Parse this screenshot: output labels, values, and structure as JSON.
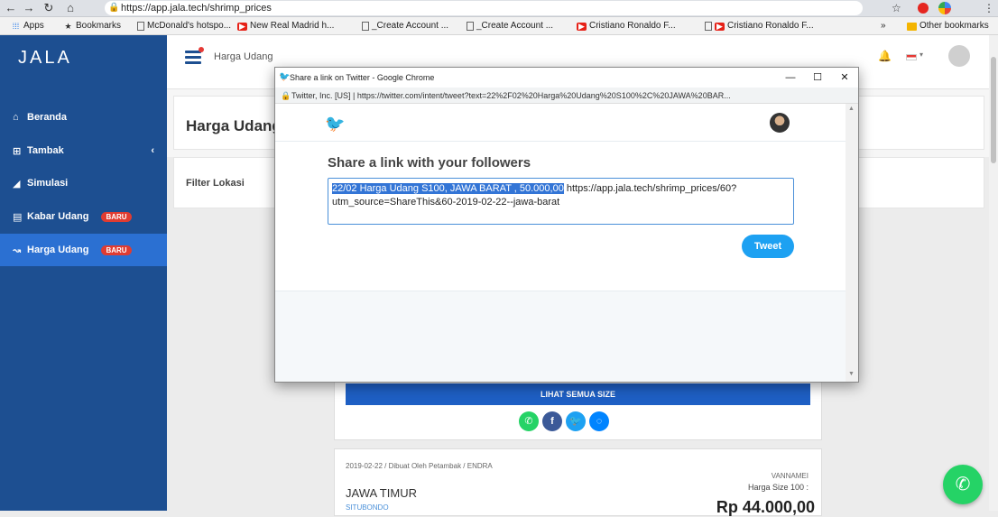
{
  "browser": {
    "url": "https://app.jala.tech/shrimp_prices",
    "bookmarks": [
      {
        "label": "Apps",
        "icon": "apps-grid-icon"
      },
      {
        "label": "Bookmarks",
        "icon": "star-icon"
      },
      {
        "label": "McDonald's hotspo...",
        "icon": "page-icon"
      },
      {
        "label": "New Real Madrid h...",
        "icon": "youtube-icon"
      },
      {
        "label": "_Create Account ...",
        "icon": "page-icon"
      },
      {
        "label": "_Create Account ...",
        "icon": "page-icon"
      },
      {
        "label": "Cristiano Ronaldo F...",
        "icon": "youtube-icon"
      },
      {
        "label": "Cristiano Ronaldo F...",
        "icon": "page-icon"
      }
    ],
    "overflow": "»",
    "other_bookmarks": "Other bookmarks"
  },
  "app": {
    "logo": "JALA",
    "sidebar": [
      {
        "label": "Beranda",
        "icon": "home-icon"
      },
      {
        "label": "Tambak",
        "icon": "grid-icon",
        "chevron": "‹"
      },
      {
        "label": "Simulasi",
        "icon": "chart-icon"
      },
      {
        "label": "Kabar Udang",
        "icon": "news-icon",
        "badge": "BARU"
      },
      {
        "label": "Harga Udang",
        "icon": "shrimp-icon",
        "badge": "BARU",
        "active": true
      }
    ],
    "breadcrumb": "Harga Udang",
    "page_title": "Harga Udang",
    "filter_label": "Filter Lokasi",
    "lihat_button": "LIHAT SEMUA SIZE",
    "share_icons": [
      "whatsapp-icon",
      "facebook-icon",
      "twitter-icon",
      "messenger-icon"
    ],
    "post": {
      "meta": "2019-02-22 / Dibuat Oleh Petambak / ENDRA",
      "species": "VANNAMEI",
      "size": "Harga Size 100 :",
      "region": "JAWA TIMUR",
      "city": "SITUBONDO",
      "price": "Rp 44.000,00"
    }
  },
  "popup": {
    "title": "Share a link on Twitter - Google Chrome",
    "address_org": "Twitter, Inc. [US]",
    "address_url": "https://twitter.com/intent/tweet?text=22%2F02%20Harga%20Udang%20S100%2C%20JAWA%20BAR...",
    "heading": "Share a link with your followers",
    "tweet_selected": "22/02 Harga Udang S100, JAWA BARAT , 50.000,00",
    "tweet_rest": " https://app.jala.tech/shrimp_prices/60?utm_source=ShareThis&60-2019-02-22--jawa-barat",
    "tweet_button": "Tweet",
    "window_buttons": {
      "minimize": "—",
      "maximize": "☐",
      "close": "✕"
    }
  },
  "colors": {
    "sidebar": "#1d4f91",
    "active": "#2b70d2",
    "twitter": "#1da1f2",
    "badge": "#e03c31"
  }
}
